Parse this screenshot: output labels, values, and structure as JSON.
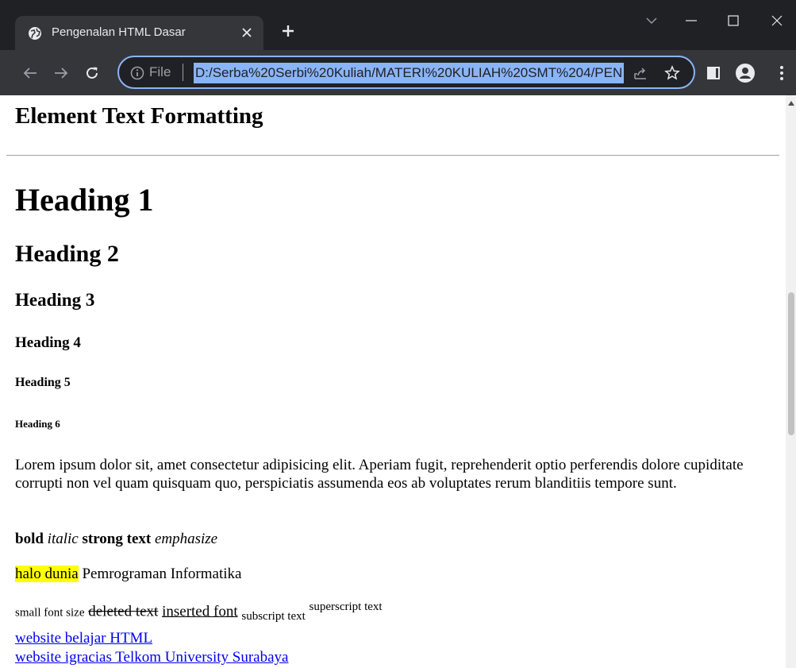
{
  "browser": {
    "tab": {
      "title": "Pengenalan HTML Dasar"
    },
    "address_bar": {
      "scheme_label": "File",
      "url": "D:/Serba%20Serbi%20Kuliah/MATERI%20KULIAH%20SMT%204/PEN"
    },
    "colors": {
      "tab_strip": "#202124",
      "toolbar": "#35363a",
      "focus_ring": "#8ab4f8",
      "icon": "#e8eaed"
    }
  },
  "page": {
    "section_title": "Element Text Formatting",
    "headings": {
      "h1": "Heading 1",
      "h2": "Heading 2",
      "h3": "Heading 3",
      "h4": "Heading 4",
      "h5": "Heading 5",
      "h6": "Heading 6"
    },
    "paragraph": "Lorem ipsum dolor sit, amet consectetur adipisicing elit. Aperiam fugit, reprehenderit optio perferendis dolore cupiditate corrupti non vel quam quisquam quo, perspiciatis assumenda eos ab voluptates rerum blanditiis tempore sunt.",
    "formatting": {
      "bold": "bold",
      "italic": "italic",
      "strong": "strong text",
      "emphasize": "emphasize"
    },
    "marked": {
      "highlight": "halo dunia",
      "rest": "Pemrograman Informatika"
    },
    "misc": {
      "small": "small font size",
      "deleted": "deleted text",
      "inserted": "inserted font",
      "subscript": "subscript text",
      "superscript": "superscript text"
    },
    "links": [
      "website belajar HTML",
      "website igracias Telkom University Surabaya"
    ],
    "colors": {
      "highlight": "#ffff00",
      "link": "#0000ee"
    }
  }
}
